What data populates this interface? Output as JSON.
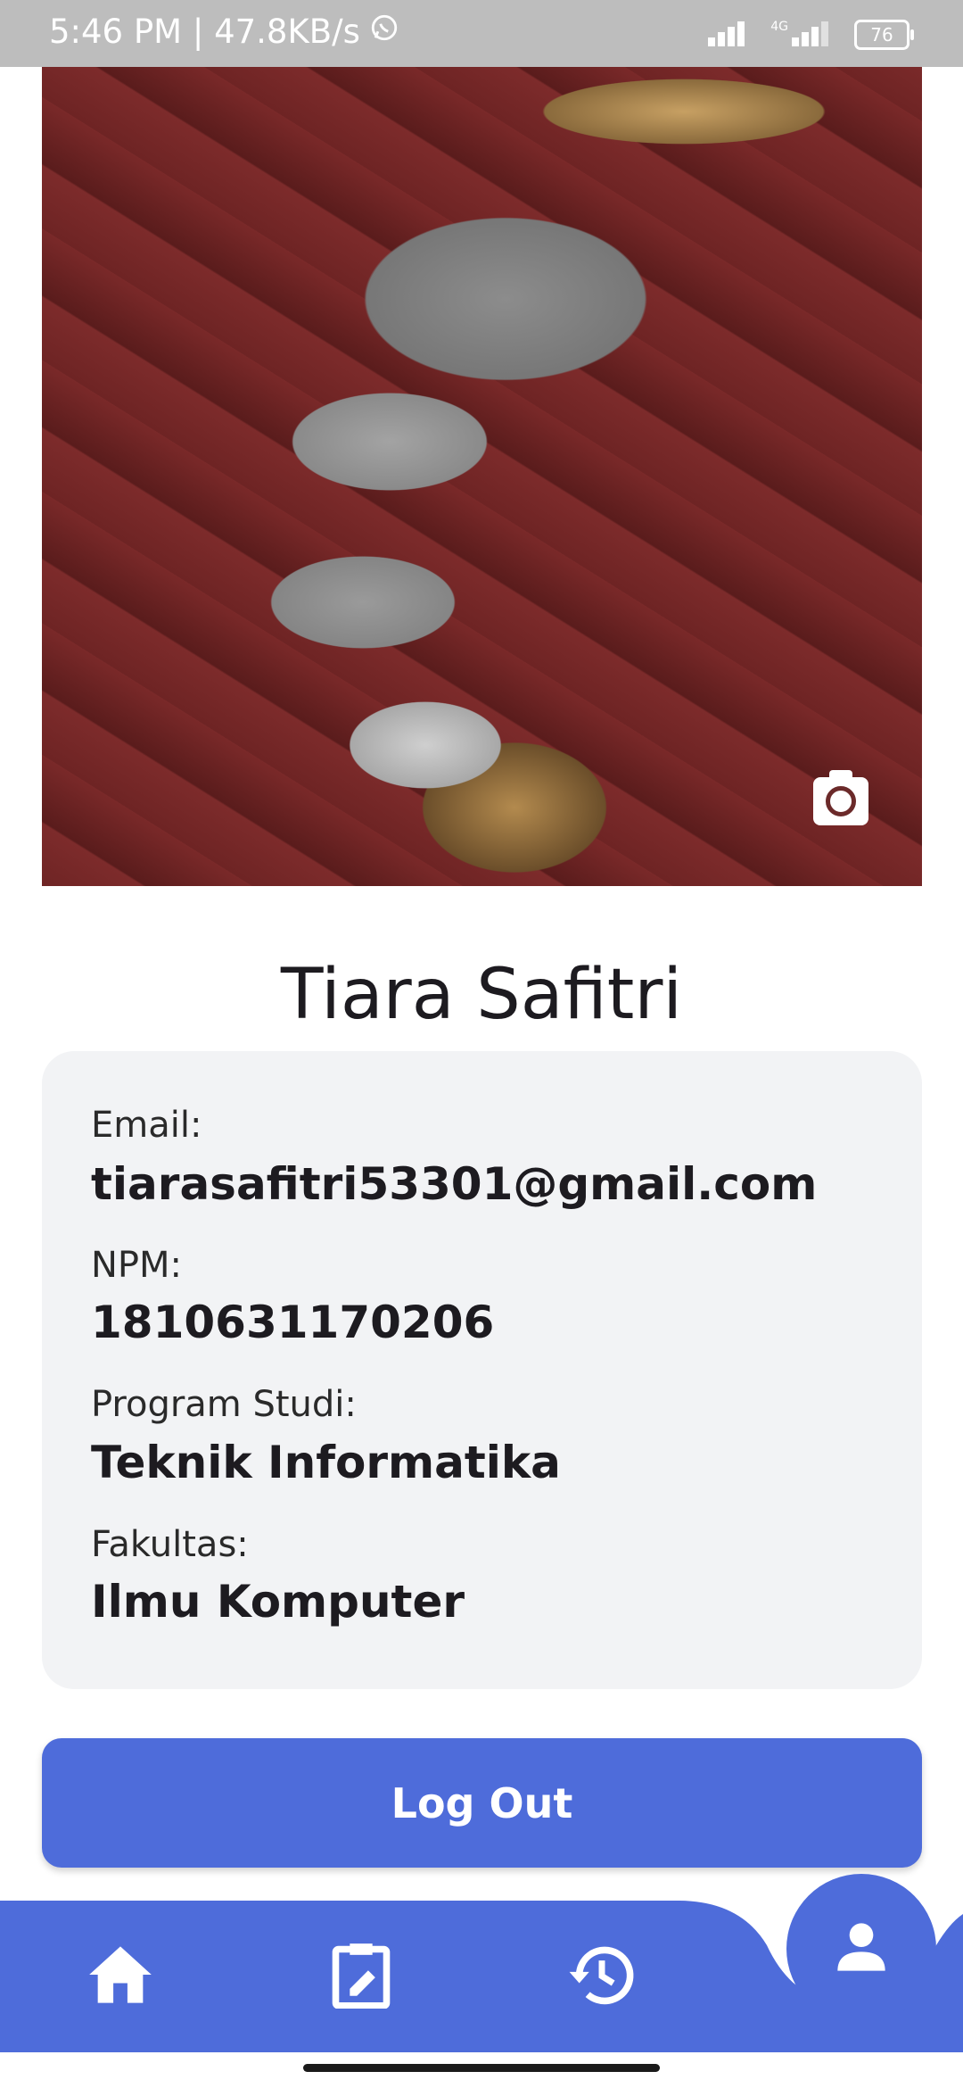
{
  "status_bar": {
    "time_speed": "5:46 PM | 47.8KB/s",
    "network_type": "4G",
    "battery": "76"
  },
  "profile": {
    "name": "Tiara Safitri"
  },
  "info": {
    "email_label": "Email:",
    "email_value": "tiarasafitri53301@gmail.com",
    "npm_label": "NPM:",
    "npm_value": "1810631170206",
    "prodi_label": "Program Studi:",
    "prodi_value": "Teknik Informatika",
    "fakultas_label": "Fakultas:",
    "fakultas_value": "Ilmu Komputer"
  },
  "actions": {
    "logout_label": "Log Out"
  },
  "nav": {
    "items": [
      "home-icon",
      "edit-note-icon",
      "history-icon",
      "person-icon"
    ],
    "active": "person-icon"
  },
  "colors": {
    "accent": "#4e6cda",
    "card_bg": "#f2f3f5",
    "status_bar": "#bdbdbd"
  }
}
